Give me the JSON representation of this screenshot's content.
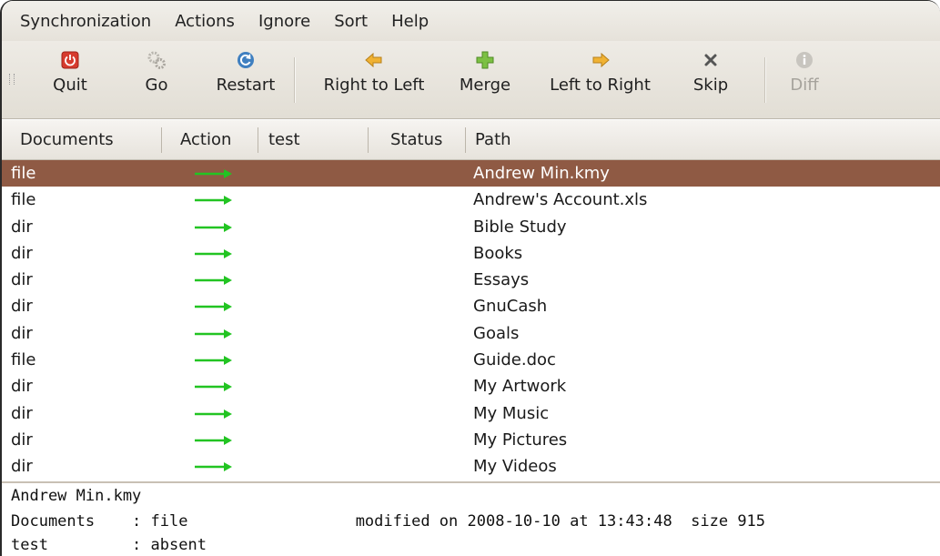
{
  "menubar": {
    "items": [
      "Synchronization",
      "Actions",
      "Ignore",
      "Sort",
      "Help"
    ]
  },
  "toolbar": {
    "quit": "Quit",
    "go": "Go",
    "restart": "Restart",
    "right_to_left": "Right to Left",
    "merge": "Merge",
    "left_to_right": "Left to Right",
    "skip": "Skip",
    "diff": "Diff"
  },
  "columns": {
    "documents": "Documents",
    "action": "Action",
    "test": "test",
    "status": "Status",
    "path": "Path"
  },
  "rows": [
    {
      "type": "file",
      "path": "Andrew Min.kmy"
    },
    {
      "type": "file",
      "path": "Andrew's Account.xls"
    },
    {
      "type": "dir",
      "path": "Bible Study"
    },
    {
      "type": "dir",
      "path": "Books"
    },
    {
      "type": "dir",
      "path": "Essays"
    },
    {
      "type": "dir",
      "path": "GnuCash"
    },
    {
      "type": "dir",
      "path": "Goals"
    },
    {
      "type": "file",
      "path": "Guide.doc"
    },
    {
      "type": "dir",
      "path": "My Artwork"
    },
    {
      "type": "dir",
      "path": "My Music"
    },
    {
      "type": "dir",
      "path": "My Pictures"
    },
    {
      "type": "dir",
      "path": "My Videos"
    }
  ],
  "details": {
    "filename": "Andrew Min.kmy",
    "line2": "Documents    : file                  modified on 2008-10-10 at 13:43:48  size 915",
    "line3": "test         : absent"
  },
  "colors": {
    "selected_row": "#8f5a44",
    "arrow": "#22c422",
    "quit_red": "#d63b2e",
    "restart_blue": "#3f7fc0",
    "orange_arrow": "#f0b233",
    "merge_green": "#7cc043"
  }
}
